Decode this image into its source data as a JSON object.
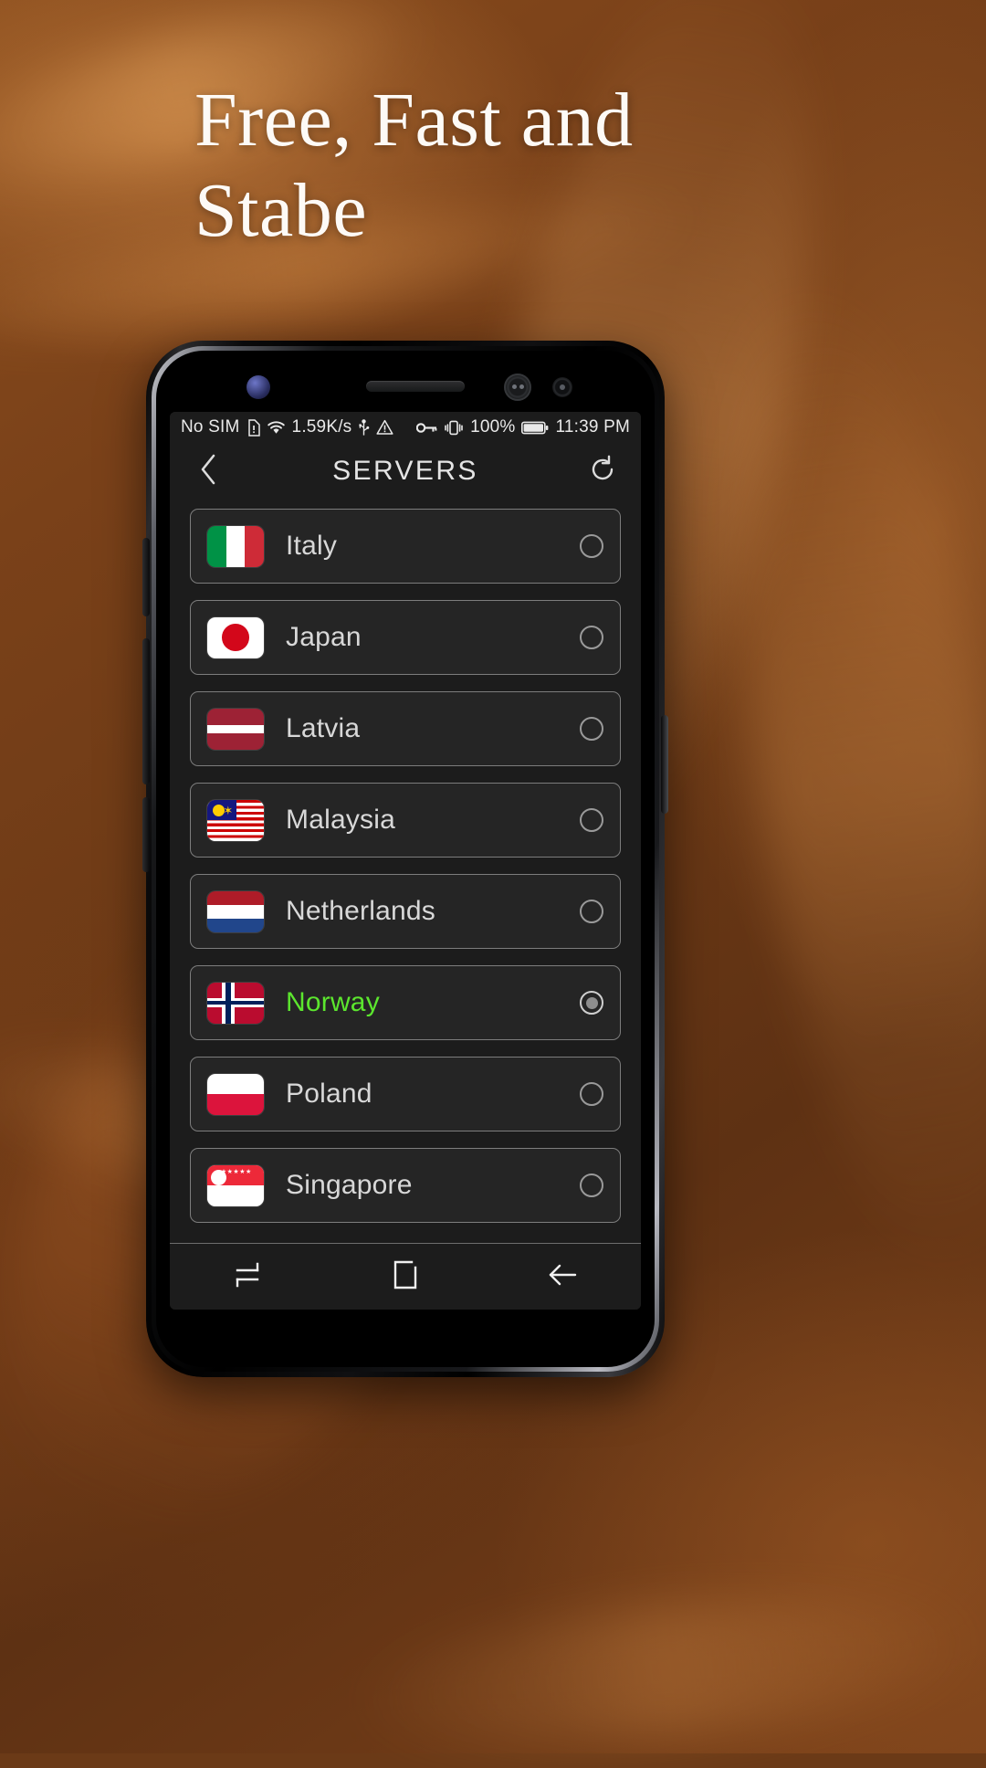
{
  "headline": {
    "line1": "Free, Fast and",
    "line2": "Stabe"
  },
  "statusbar": {
    "sim": "No SIM",
    "sim_alert_icon": "sim-alert-icon",
    "wifi_icon": "wifi-icon",
    "network_speed": "1.59K/s",
    "usb_icon": "usb-icon",
    "warning_icon": "warning-triangle-icon",
    "vpn_key_icon": "vpn-key-icon",
    "vibrate_icon": "vibrate-icon",
    "battery_percent": "100%",
    "battery_icon": "battery-full-icon",
    "time": "11:39 PM"
  },
  "appbar": {
    "back_icon": "back-chevron-icon",
    "title": "SERVERS",
    "refresh_icon": "refresh-icon"
  },
  "servers": [
    {
      "name": "Italy",
      "flag": "flag-italy",
      "selected": false
    },
    {
      "name": "Japan",
      "flag": "flag-japan",
      "selected": false
    },
    {
      "name": "Latvia",
      "flag": "flag-latvia",
      "selected": false
    },
    {
      "name": "Malaysia",
      "flag": "flag-malaysia",
      "selected": false
    },
    {
      "name": "Netherlands",
      "flag": "flag-netherlands",
      "selected": false
    },
    {
      "name": "Norway",
      "flag": "flag-norway",
      "selected": true
    },
    {
      "name": "Poland",
      "flag": "flag-poland",
      "selected": false
    },
    {
      "name": "Singapore",
      "flag": "flag-singapore",
      "selected": false
    }
  ],
  "navbar": {
    "recents_icon": "recents-icon",
    "home_icon": "home-square-icon",
    "back_icon": "back-arrow-icon"
  },
  "colors": {
    "selected_text": "#5CE62E",
    "screen_bg": "#1c1c1c",
    "row_bg": "#252525",
    "row_border": "#7d7d7d",
    "label_text": "#d8d8d8",
    "background_brown": "#6d3a16"
  }
}
